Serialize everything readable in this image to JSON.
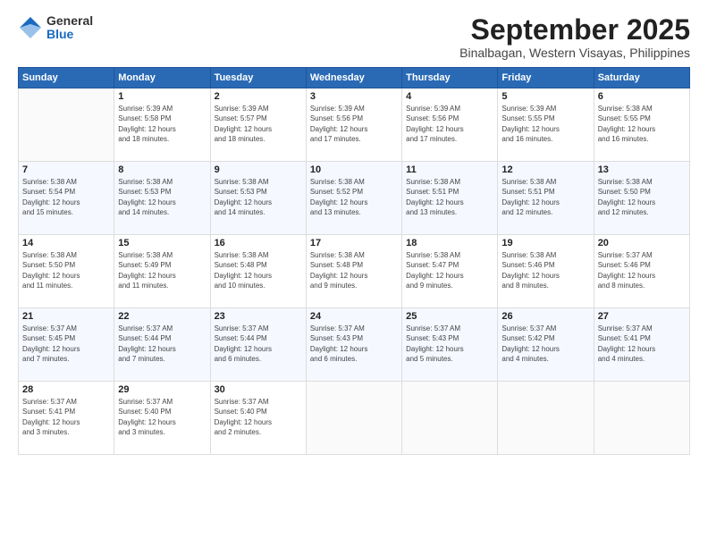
{
  "header": {
    "logo_general": "General",
    "logo_blue": "Blue",
    "title": "September 2025",
    "location": "Binalbagan, Western Visayas, Philippines"
  },
  "calendar": {
    "days_of_week": [
      "Sunday",
      "Monday",
      "Tuesday",
      "Wednesday",
      "Thursday",
      "Friday",
      "Saturday"
    ],
    "weeks": [
      [
        {
          "day": "",
          "info": ""
        },
        {
          "day": "1",
          "info": "Sunrise: 5:39 AM\nSunset: 5:58 PM\nDaylight: 12 hours\nand 18 minutes."
        },
        {
          "day": "2",
          "info": "Sunrise: 5:39 AM\nSunset: 5:57 PM\nDaylight: 12 hours\nand 18 minutes."
        },
        {
          "day": "3",
          "info": "Sunrise: 5:39 AM\nSunset: 5:56 PM\nDaylight: 12 hours\nand 17 minutes."
        },
        {
          "day": "4",
          "info": "Sunrise: 5:39 AM\nSunset: 5:56 PM\nDaylight: 12 hours\nand 17 minutes."
        },
        {
          "day": "5",
          "info": "Sunrise: 5:39 AM\nSunset: 5:55 PM\nDaylight: 12 hours\nand 16 minutes."
        },
        {
          "day": "6",
          "info": "Sunrise: 5:38 AM\nSunset: 5:55 PM\nDaylight: 12 hours\nand 16 minutes."
        }
      ],
      [
        {
          "day": "7",
          "info": "Sunrise: 5:38 AM\nSunset: 5:54 PM\nDaylight: 12 hours\nand 15 minutes."
        },
        {
          "day": "8",
          "info": "Sunrise: 5:38 AM\nSunset: 5:53 PM\nDaylight: 12 hours\nand 14 minutes."
        },
        {
          "day": "9",
          "info": "Sunrise: 5:38 AM\nSunset: 5:53 PM\nDaylight: 12 hours\nand 14 minutes."
        },
        {
          "day": "10",
          "info": "Sunrise: 5:38 AM\nSunset: 5:52 PM\nDaylight: 12 hours\nand 13 minutes."
        },
        {
          "day": "11",
          "info": "Sunrise: 5:38 AM\nSunset: 5:51 PM\nDaylight: 12 hours\nand 13 minutes."
        },
        {
          "day": "12",
          "info": "Sunrise: 5:38 AM\nSunset: 5:51 PM\nDaylight: 12 hours\nand 12 minutes."
        },
        {
          "day": "13",
          "info": "Sunrise: 5:38 AM\nSunset: 5:50 PM\nDaylight: 12 hours\nand 12 minutes."
        }
      ],
      [
        {
          "day": "14",
          "info": "Sunrise: 5:38 AM\nSunset: 5:50 PM\nDaylight: 12 hours\nand 11 minutes."
        },
        {
          "day": "15",
          "info": "Sunrise: 5:38 AM\nSunset: 5:49 PM\nDaylight: 12 hours\nand 11 minutes."
        },
        {
          "day": "16",
          "info": "Sunrise: 5:38 AM\nSunset: 5:48 PM\nDaylight: 12 hours\nand 10 minutes."
        },
        {
          "day": "17",
          "info": "Sunrise: 5:38 AM\nSunset: 5:48 PM\nDaylight: 12 hours\nand 9 minutes."
        },
        {
          "day": "18",
          "info": "Sunrise: 5:38 AM\nSunset: 5:47 PM\nDaylight: 12 hours\nand 9 minutes."
        },
        {
          "day": "19",
          "info": "Sunrise: 5:38 AM\nSunset: 5:46 PM\nDaylight: 12 hours\nand 8 minutes."
        },
        {
          "day": "20",
          "info": "Sunrise: 5:37 AM\nSunset: 5:46 PM\nDaylight: 12 hours\nand 8 minutes."
        }
      ],
      [
        {
          "day": "21",
          "info": "Sunrise: 5:37 AM\nSunset: 5:45 PM\nDaylight: 12 hours\nand 7 minutes."
        },
        {
          "day": "22",
          "info": "Sunrise: 5:37 AM\nSunset: 5:44 PM\nDaylight: 12 hours\nand 7 minutes."
        },
        {
          "day": "23",
          "info": "Sunrise: 5:37 AM\nSunset: 5:44 PM\nDaylight: 12 hours\nand 6 minutes."
        },
        {
          "day": "24",
          "info": "Sunrise: 5:37 AM\nSunset: 5:43 PM\nDaylight: 12 hours\nand 6 minutes."
        },
        {
          "day": "25",
          "info": "Sunrise: 5:37 AM\nSunset: 5:43 PM\nDaylight: 12 hours\nand 5 minutes."
        },
        {
          "day": "26",
          "info": "Sunrise: 5:37 AM\nSunset: 5:42 PM\nDaylight: 12 hours\nand 4 minutes."
        },
        {
          "day": "27",
          "info": "Sunrise: 5:37 AM\nSunset: 5:41 PM\nDaylight: 12 hours\nand 4 minutes."
        }
      ],
      [
        {
          "day": "28",
          "info": "Sunrise: 5:37 AM\nSunset: 5:41 PM\nDaylight: 12 hours\nand 3 minutes."
        },
        {
          "day": "29",
          "info": "Sunrise: 5:37 AM\nSunset: 5:40 PM\nDaylight: 12 hours\nand 3 minutes."
        },
        {
          "day": "30",
          "info": "Sunrise: 5:37 AM\nSunset: 5:40 PM\nDaylight: 12 hours\nand 2 minutes."
        },
        {
          "day": "",
          "info": ""
        },
        {
          "day": "",
          "info": ""
        },
        {
          "day": "",
          "info": ""
        },
        {
          "day": "",
          "info": ""
        }
      ]
    ]
  }
}
